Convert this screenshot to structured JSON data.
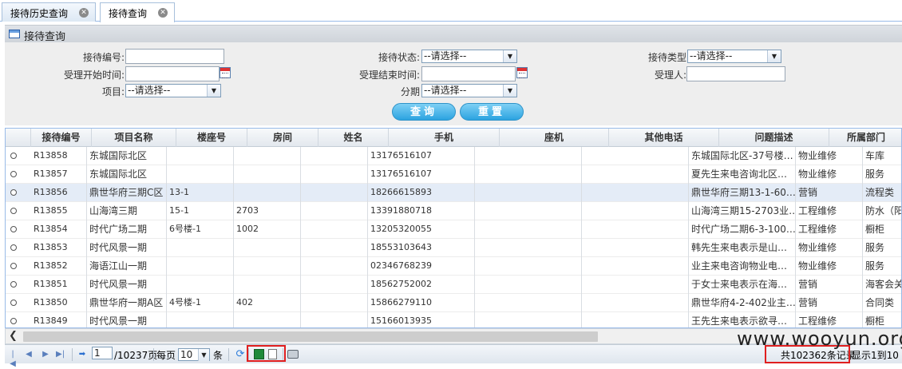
{
  "tabs": [
    {
      "label": "接待历史查询"
    },
    {
      "label": "接待查询"
    }
  ],
  "panel": {
    "title": "接待查询"
  },
  "form": {
    "reception_no_label": "接待编号:",
    "reception_status_label": "接待状态:",
    "reception_status_value": "--请选择--",
    "reception_type_label": "接待类型",
    "reception_type_value": "--请选择--",
    "accept_start_label": "受理开始时间:",
    "accept_end_label": "受理结束时间:",
    "accept_person_label": "受理人:",
    "project_label": "项目:",
    "project_value": "--请选择--",
    "phase_label": "分期",
    "phase_value": "--请选择--",
    "search_label": "查询",
    "reset_label": "重置"
  },
  "grid": {
    "columns": [
      "接待编号",
      "项目名称",
      "楼座号",
      "房间",
      "姓名",
      "手机",
      "座机",
      "其他电话",
      "问题描述",
      "所属部门"
    ],
    "rows": [
      [
        "R13858",
        "东城国际北区",
        "",
        "",
        "",
        "13176516107",
        "",
        "",
        "东城国际北区-37号楼…",
        "物业维修",
        "车库"
      ],
      [
        "R13857",
        "东城国际北区",
        "",
        "",
        "",
        "13176516107",
        "",
        "",
        "夏先生来电咨询北区…",
        "物业维修",
        "服务"
      ],
      [
        "R13856",
        "鼎世华府三期C区",
        "13-1",
        "",
        "",
        "18266615893",
        "",
        "",
        "鼎世华府三期13-1-60…",
        "营销",
        "流程类"
      ],
      [
        "R13855",
        "山海湾三期",
        "15-1",
        "2703",
        "",
        "13391880718",
        "",
        "",
        "山海湾三期15-2703业…",
        "工程维修",
        "防水（阳"
      ],
      [
        "R13854",
        "时代广场二期",
        "6号楼-1",
        "1002",
        "",
        "13205320055",
        "",
        "",
        "时代广场二期6-3-100…",
        "工程维修",
        "橱柜"
      ],
      [
        "R13853",
        "时代风景一期",
        "",
        "",
        "",
        "18553103643",
        "",
        "",
        "韩先生来电表示是山…",
        "物业维修",
        "服务"
      ],
      [
        "R13852",
        "海语江山一期",
        "",
        "",
        "",
        "02346768239",
        "",
        "",
        "业主来电咨询物业电…",
        "物业维修",
        "服务"
      ],
      [
        "R13851",
        "时代风景一期",
        "",
        "",
        "",
        "18562752002",
        "",
        "",
        "于女士来电表示在海…",
        "营销",
        "海客会关"
      ],
      [
        "R13850",
        "鼎世华府一期A区",
        "4号楼-1",
        "402",
        "",
        "15866279110",
        "",
        "",
        "鼎世华府4-2-402业主…",
        "营销",
        "合同类"
      ],
      [
        "R13849",
        "时代风景一期",
        "",
        "",
        "",
        "15166013935",
        "",
        "",
        "王先生来电表示欲寻…",
        "工程维修",
        "橱柜"
      ]
    ]
  },
  "pager": {
    "page_value": "1",
    "total_pages": "/10237页",
    "per_page_label": "每页",
    "per_page_value": "10",
    "per_page_unit": "条",
    "total_records": "共102362条记录",
    "display_range": "显示1到10"
  },
  "watermark": "www.wooyun.org"
}
